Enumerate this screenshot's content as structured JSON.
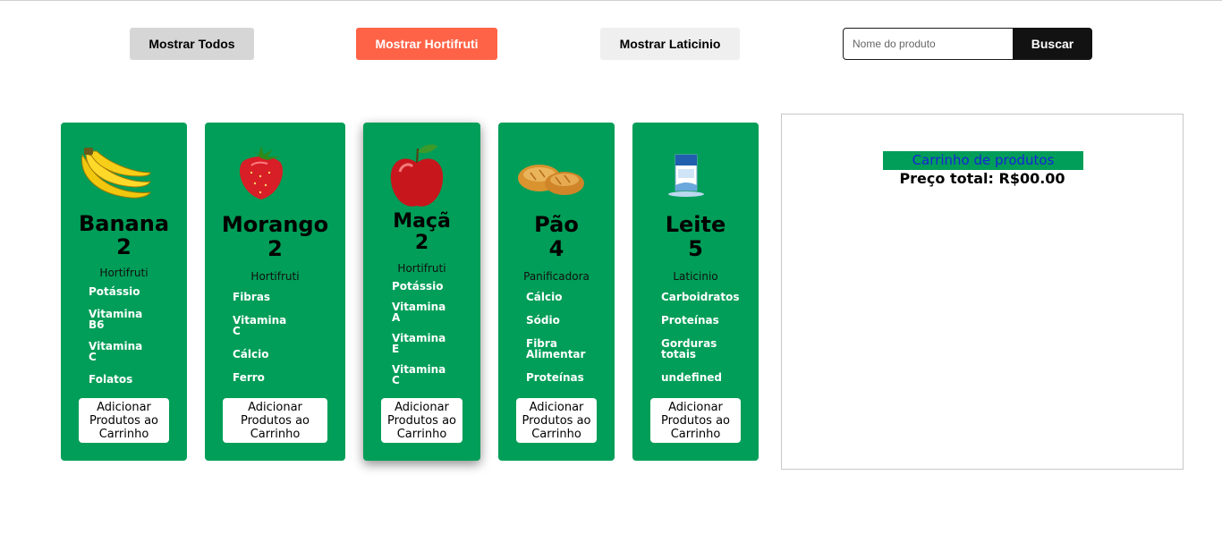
{
  "filters": {
    "all_label": "Mostrar Todos",
    "horti_label": "Mostrar Hortifruti",
    "latic_label": "Mostrar Laticinio"
  },
  "search": {
    "placeholder": "Nome do produto",
    "button_label": "Buscar"
  },
  "products": [
    {
      "name": "Banana",
      "price": "2",
      "category": "Hortifruti",
      "image_icon": "banana-icon",
      "nutrients": [
        "Potássio",
        "Vitamina B6",
        "Vitamina C",
        "Folatos"
      ],
      "add_label": "Adicionar Produtos ao Carrinho"
    },
    {
      "name": "Morango",
      "price": "2",
      "category": "Hortifruti",
      "image_icon": "strawberry-icon",
      "nutrients": [
        "Fibras",
        "Vitamina C",
        "Cálcio",
        "Ferro"
      ],
      "add_label": "Adicionar Produtos ao Carrinho"
    },
    {
      "name": "Maçã",
      "price": "2",
      "category": "Hortifruti",
      "image_icon": "apple-icon",
      "nutrients": [
        "Potássio",
        "Vitamina A",
        "Vitamina E",
        "Vitamina C"
      ],
      "add_label": "Adicionar Produtos ao Carrinho"
    },
    {
      "name": "Pão",
      "price": "4",
      "category": "Panificadora",
      "image_icon": "bread-icon",
      "nutrients": [
        "Cálcio",
        "Sódio",
        "Fibra Alimentar",
        "Proteínas"
      ],
      "add_label": "Adicionar Produtos ao Carrinho"
    },
    {
      "name": "Leite",
      "price": "5",
      "category": "Laticinio",
      "image_icon": "milk-carton-icon",
      "nutrients": [
        "Carboidratos",
        "Proteínas",
        "Gorduras totais",
        "undefined"
      ],
      "add_label": "Adicionar Produtos ao Carrinho"
    }
  ],
  "cart": {
    "title": "Carrinho de produtos",
    "total": "Preço total: R$00.00"
  },
  "colors": {
    "card_green": "#009e58",
    "horti_accent": "#ff6347",
    "search_button": "#121212",
    "cart_title_text": "#1a24d6"
  }
}
